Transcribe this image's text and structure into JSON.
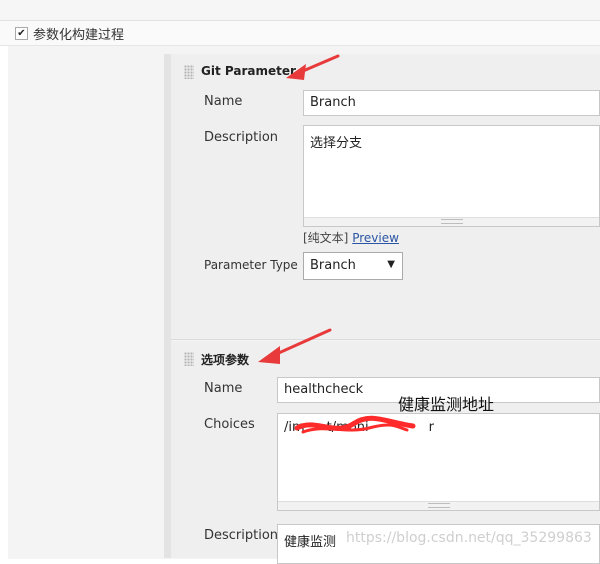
{
  "top": {
    "checkbox_mark": "✔",
    "checkbox_label": "参数化构建过程"
  },
  "git_param": {
    "title": "Git Parameter",
    "name_label": "Name",
    "name_value": "Branch",
    "description_label": "Description",
    "description_value": "选择分支",
    "format_plain": "[纯文本]",
    "preview": "Preview",
    "param_type_label": "Parameter Type",
    "param_type_value": "Branch"
  },
  "choice_param": {
    "title": "选项参数",
    "name_label": "Name",
    "name_value": "healthcheck",
    "choices_label": "Choices",
    "choices_value_visible_start": "/im",
    "choices_value_visible_mid": "t/moni",
    "choices_value_visible_end": "r",
    "description_label": "Description",
    "description_value": "健康监测"
  },
  "annotation_text": "健康监测地址",
  "watermark": "https://blog.csdn.net/qq_35299863",
  "colors": {
    "annotation_arrow": "#e83a3a",
    "redaction": "#ff2a2a",
    "link": "#2a55a5"
  }
}
